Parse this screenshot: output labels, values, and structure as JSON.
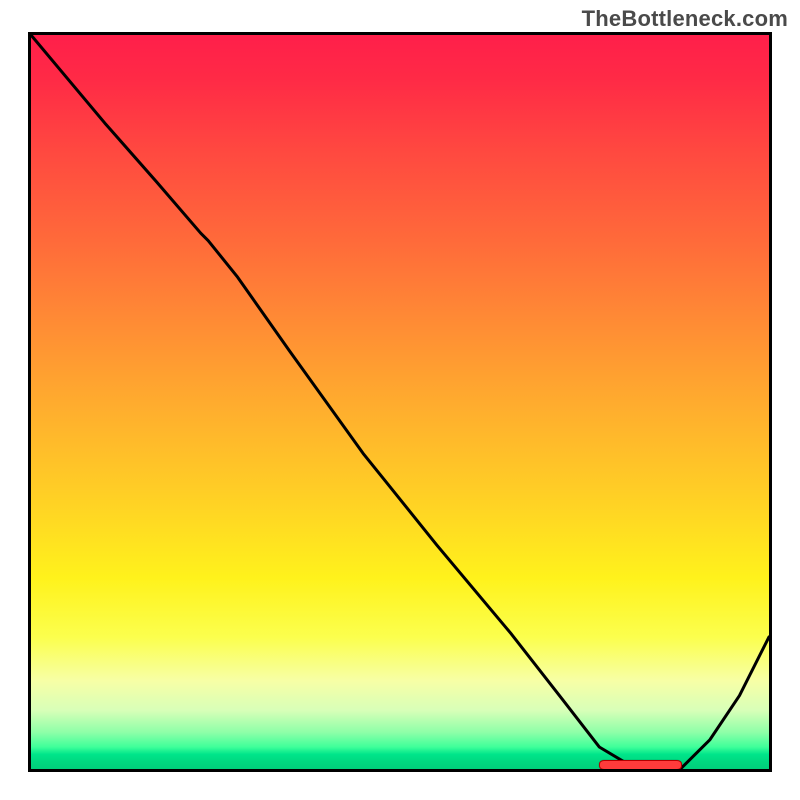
{
  "watermark": "TheBottleneck.com",
  "colors": {
    "frame": "#000000",
    "curve": "#000000",
    "marker_fill": "#ff3b3b",
    "marker_border": "#b50000",
    "gradient_top": "#ff1f4a",
    "gradient_bottom": "#00cf7b"
  },
  "chart_data": {
    "type": "line",
    "title": "",
    "xlabel": "",
    "ylabel": "",
    "xlim": [
      0,
      1
    ],
    "ylim": [
      0,
      1
    ],
    "grid": false,
    "series": [
      {
        "name": "bottleneck-curve",
        "x": [
          0.0,
          0.05,
          0.1,
          0.17,
          0.23,
          0.24,
          0.28,
          0.35,
          0.45,
          0.55,
          0.65,
          0.72,
          0.77,
          0.82,
          0.88,
          0.92,
          0.96,
          1.0
        ],
        "values": [
          1.0,
          0.94,
          0.88,
          0.8,
          0.73,
          0.72,
          0.67,
          0.57,
          0.43,
          0.305,
          0.185,
          0.095,
          0.03,
          0.0,
          0.0,
          0.04,
          0.1,
          0.18
        ]
      }
    ],
    "marker": {
      "name": "highlight-segment",
      "x_start": 0.77,
      "x_end": 0.88,
      "y": 0.0
    }
  }
}
